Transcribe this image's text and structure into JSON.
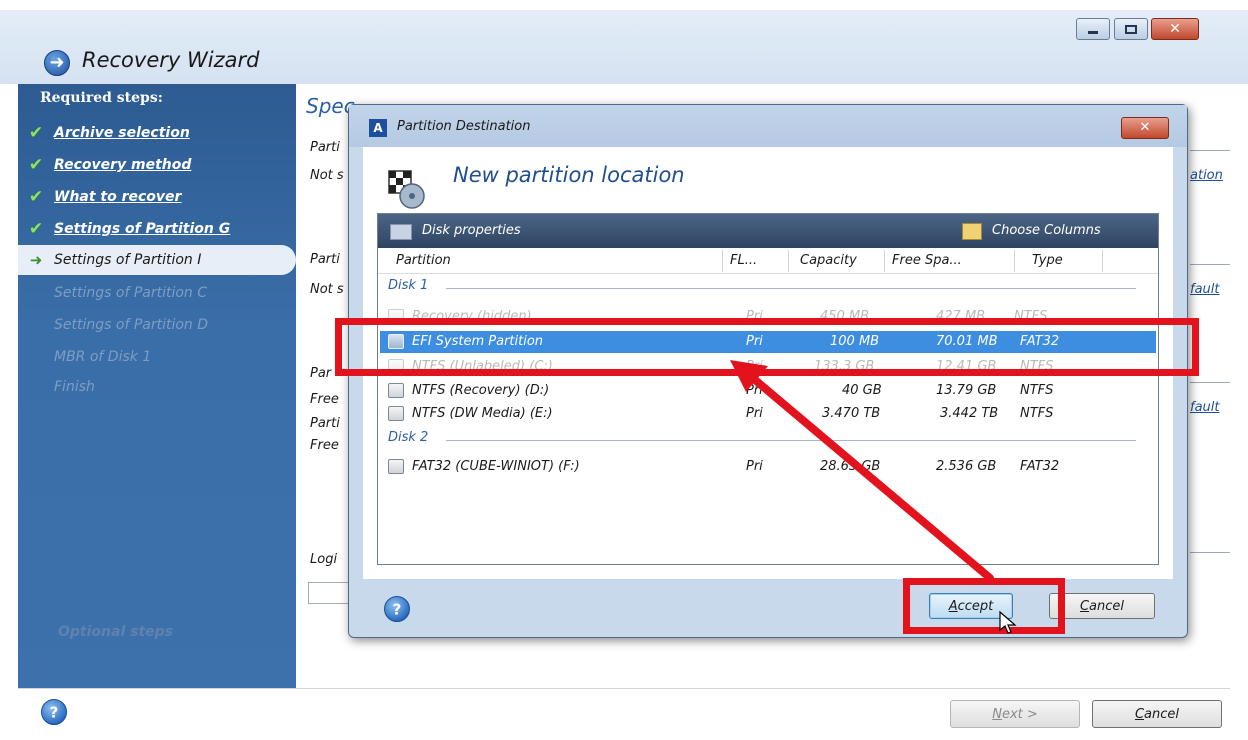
{
  "window": {
    "title": "Recovery Wizard",
    "close_glyph": "✕"
  },
  "steps": {
    "heading": "Required steps:",
    "items": [
      {
        "label": "Archive selection",
        "state": "done"
      },
      {
        "label": "Recovery method",
        "state": "done"
      },
      {
        "label": "What to recover",
        "state": "done"
      },
      {
        "label": "Settings of Partition G",
        "state": "done"
      },
      {
        "label": "Settings of Partition I",
        "state": "current"
      },
      {
        "label": "Settings of Partition C",
        "state": "pending"
      },
      {
        "label": "Settings of Partition D",
        "state": "pending"
      },
      {
        "label": "MBR of Disk 1",
        "state": "pending"
      },
      {
        "label": "Finish",
        "state": "pending"
      }
    ],
    "optional_heading": "Optional steps"
  },
  "content": {
    "title_partial": "Spec",
    "label_1": "Parti",
    "label_2": "Not s",
    "link_1": "ation",
    "label_3": "Parti",
    "label_4": "Not s",
    "link_2": "fault",
    "label_5": "Par",
    "label_6": "Free",
    "label_7": "Parti",
    "label_8": "Free",
    "link_3": "fault",
    "label_9": "Logi"
  },
  "footer": {
    "next_label": "Next >",
    "cancel_label": "Cancel"
  },
  "dialog": {
    "title": "Partition Destination",
    "heading": "New partition location",
    "close_glyph": "✕",
    "toolbar": {
      "disk_properties": "Disk properties",
      "choose_columns": "Choose Columns"
    },
    "columns": [
      "Partition",
      "FL...",
      "Capacity",
      "Free Spa...",
      "Type"
    ],
    "disks": [
      {
        "label": "Disk 1",
        "partitions": [
          {
            "name": "Recovery (hidden)",
            "flags": "Pri",
            "capacity": "450 MB",
            "free": "427 MB",
            "type": "NTFS",
            "state": "faded"
          },
          {
            "name": "EFI System Partition",
            "flags": "Pri",
            "capacity": "100 MB",
            "free": "70.01 MB",
            "type": "FAT32",
            "state": "selected"
          },
          {
            "name": "NTFS (Unlabeled) (C:)",
            "flags": "Pri",
            "capacity": "133.3 GB",
            "free": "12.41 GB",
            "type": "NTFS",
            "state": "faded"
          },
          {
            "name": "NTFS (Recovery) (D:)",
            "flags": "Pri",
            "capacity": "40 GB",
            "free": "13.79 GB",
            "type": "NTFS",
            "state": "normal"
          },
          {
            "name": "NTFS (DW Media) (E:)",
            "flags": "Pri",
            "capacity": "3.470 TB",
            "free": "3.442 TB",
            "type": "NTFS",
            "state": "normal"
          }
        ]
      },
      {
        "label": "Disk 2",
        "partitions": [
          {
            "name": "FAT32 (CUBE-WINIOT) (F:)",
            "flags": "Pri",
            "capacity": "28.63 GB",
            "free": "2.536 GB",
            "type": "FAT32",
            "state": "normal"
          }
        ]
      }
    ],
    "accept_label": "Accept",
    "cancel_label": "Cancel"
  },
  "colors": {
    "annotation_red": "#e3131e",
    "selection_blue": "#3d8ee0",
    "step_panel_blue": "#3a6ea8"
  }
}
